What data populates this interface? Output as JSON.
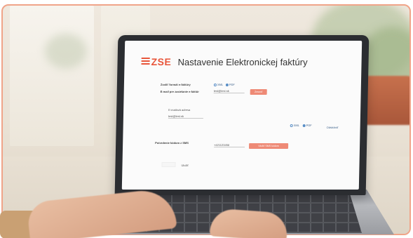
{
  "brand": {
    "logo": "ZSE",
    "color": "#e8563b"
  },
  "page": {
    "title": "Nastavenie Elektronickej faktúry"
  },
  "form": {
    "format_label": "Zvoliť formát e-faktúry",
    "format_options": [
      "XML",
      "PDF"
    ],
    "format_selected": "PDF",
    "email_label": "E-mail pre zasielanie e-faktúr",
    "email_value": "test@test.sk",
    "email_button": "Zmeniť",
    "other_email_label": "E-mailová adresa",
    "other_email_value": "test@test.sk",
    "other_format_options": [
      "XML",
      "PDF"
    ],
    "other_format_selected": "PDF",
    "remove_link": "Odstrániť",
    "sms_label": "Potvrdenie kódom z SMS",
    "phone_value": "+421123456",
    "sms_button": "Vložiť SMS kódom",
    "save_label": "Uložiť"
  },
  "colors": {
    "accent": "#ee8a76",
    "link": "#3a5f8a",
    "frame": "#f0a489"
  }
}
